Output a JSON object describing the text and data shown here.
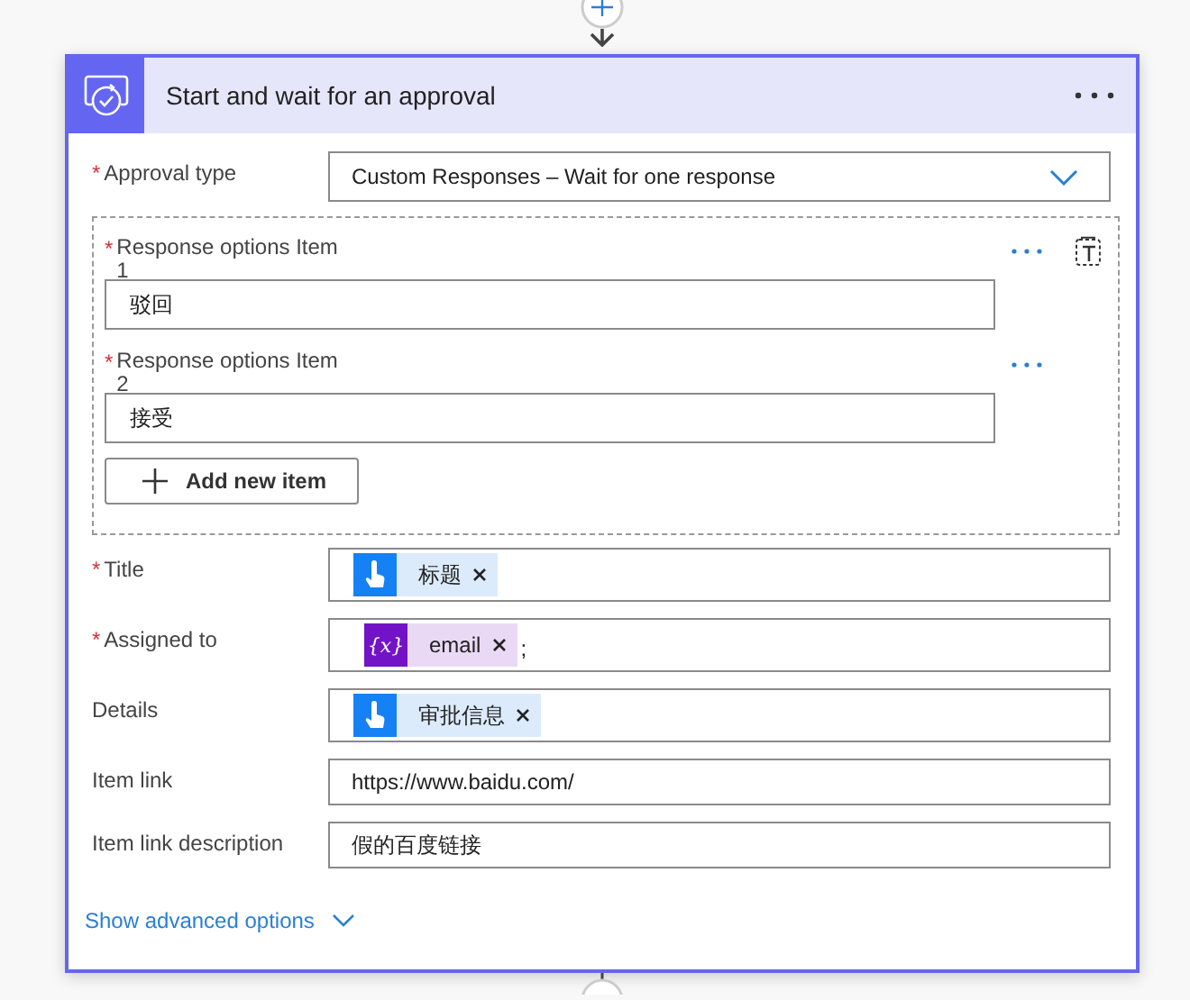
{
  "card": {
    "title": "Start and wait for an approval"
  },
  "required_mark": "*",
  "approval_type": {
    "label": "Approval type",
    "required": true,
    "value": "Custom Responses – Wait for one response"
  },
  "response_options": {
    "items": [
      {
        "label": "Response options Item 1",
        "required": true,
        "value": "驳回"
      },
      {
        "label": "Response options Item 2",
        "required": true,
        "value": "接受"
      }
    ],
    "add_button": "Add new item"
  },
  "fields": [
    {
      "label": "Title",
      "required": true,
      "kind": "tokens",
      "tokens": [
        {
          "kind": "trigger",
          "text": "标题"
        }
      ]
    },
    {
      "label": "Assigned to",
      "required": true,
      "kind": "tokens",
      "tokens": [
        {
          "kind": "variable",
          "icon_text": "{x}",
          "text": "email"
        }
      ],
      "suffix": ";"
    },
    {
      "label": "Details",
      "required": false,
      "kind": "tokens",
      "tokens": [
        {
          "kind": "trigger",
          "text": "审批信息"
        }
      ]
    },
    {
      "label": "Item link",
      "required": false,
      "kind": "text",
      "value": "https://www.baidu.com/"
    },
    {
      "label": "Item link description",
      "required": false,
      "kind": "text",
      "value": "假的百度链接"
    }
  ],
  "advanced_link": "Show advanced options"
}
